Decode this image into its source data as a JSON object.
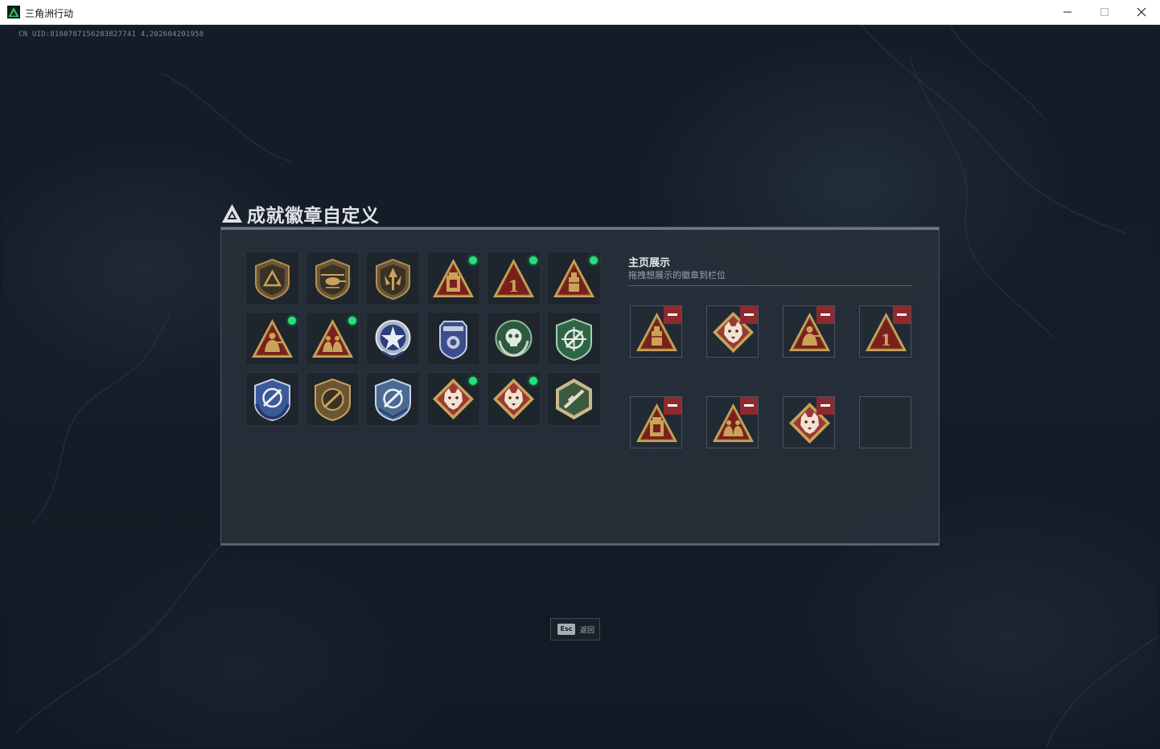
{
  "window": {
    "title": "三角洲行动",
    "controls": [
      "minimize-icon",
      "maximize-icon",
      "close-icon"
    ]
  },
  "uid_text": "CN UID:8160787156283827741 4,202604201958",
  "panel": {
    "title": "成就徽章自定义",
    "title_icon": "triangle-logo-icon"
  },
  "badges": [
    {
      "icon": "shield-triangle-badge",
      "new": false
    },
    {
      "icon": "helicopter-shield-badge",
      "new": false
    },
    {
      "icon": "arrow-shield-badge",
      "new": false
    },
    {
      "icon": "gold-tower-triangle-badge",
      "new": true
    },
    {
      "icon": "number-one-triangle-badge",
      "new": true
    },
    {
      "icon": "gold-container-triangle-badge",
      "new": true
    },
    {
      "icon": "gold-soldier-triangle-badge",
      "new": true
    },
    {
      "icon": "gold-squad-triangle-badge",
      "new": true
    },
    {
      "icon": "blue-star-medal-badge",
      "new": false
    },
    {
      "icon": "blue-police-badge",
      "new": false
    },
    {
      "icon": "green-skull-laurel-badge",
      "new": false
    },
    {
      "icon": "green-crosshair-shield-badge",
      "new": false
    },
    {
      "icon": "blue-crosshair-laurel-badge",
      "new": false
    },
    {
      "icon": "gold-rifle-shield-badge",
      "new": false
    },
    {
      "icon": "blue-crosshair-shield-badge",
      "new": false
    },
    {
      "icon": "wolf-diamond-badge",
      "new": true
    },
    {
      "icon": "wolf-diamond-badge",
      "new": true
    },
    {
      "icon": "green-hexagon-gun-badge",
      "new": false
    }
  ],
  "showcase": {
    "title": "主页展示",
    "subtitle": "拖拽想展示的徽章到栏位",
    "slots": [
      {
        "icon": "gold-container-triangle-badge",
        "removable": true
      },
      {
        "icon": "wolf-diamond-badge",
        "removable": true
      },
      {
        "icon": "gold-soldier-triangle-badge",
        "removable": true
      },
      {
        "icon": "number-one-triangle-badge",
        "removable": true
      },
      {
        "icon": "gold-tower-triangle-badge",
        "removable": true
      },
      {
        "icon": "gold-squad-triangle-badge",
        "removable": true
      },
      {
        "icon": "wolf-diamond-badge",
        "removable": true
      },
      {
        "icon": "empty-slot",
        "removable": false
      }
    ]
  },
  "esc_hint": {
    "key": "Esc",
    "label": "返回"
  },
  "colors": {
    "new_dot": "#27e07a",
    "remove_button": "#8e2a2e",
    "gold": "#c9a35a",
    "triangle_red": "#7a1f1c"
  }
}
